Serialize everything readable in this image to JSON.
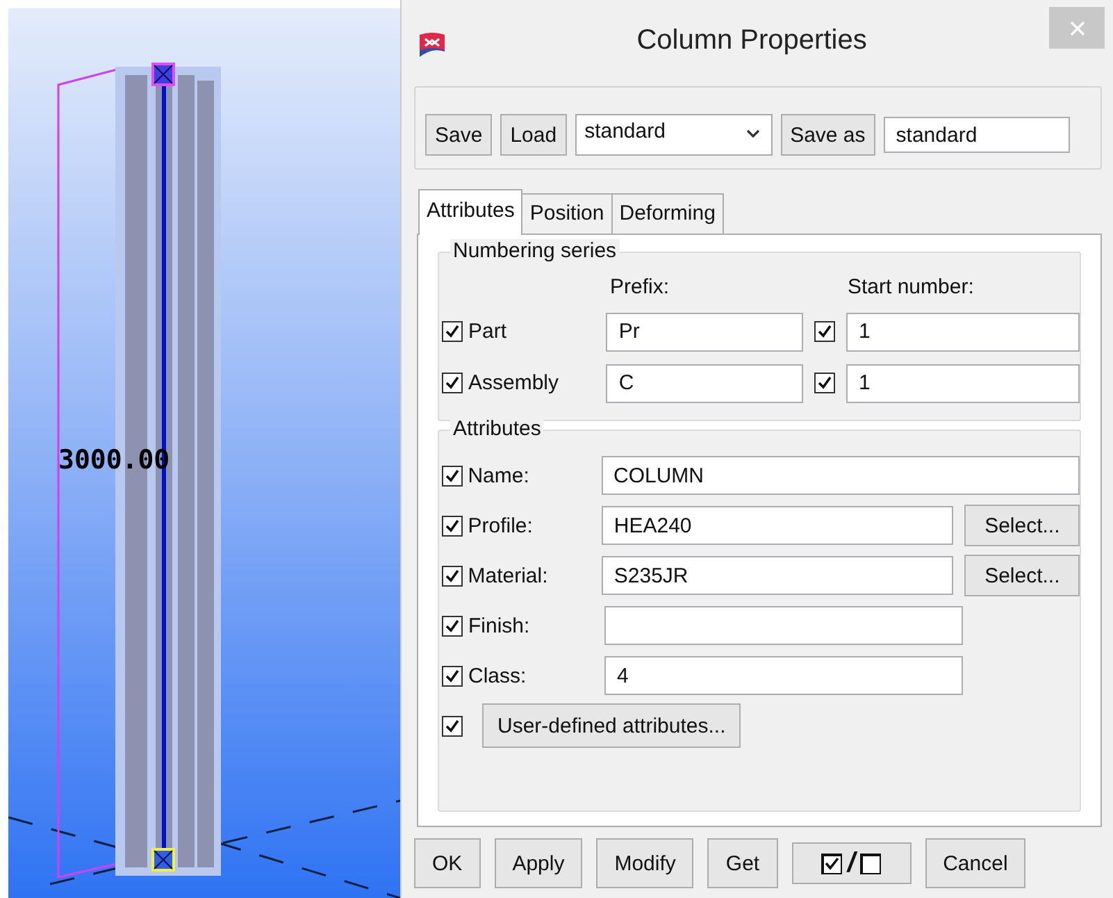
{
  "viewport": {
    "dimension_label": "3000.00"
  },
  "window": {
    "title": "Column Properties"
  },
  "toolbar": {
    "save": "Save",
    "load": "Load",
    "attribute_set": "standard",
    "save_as": "Save as",
    "save_as_name": "standard"
  },
  "tabs": [
    {
      "label": "Attributes",
      "selected": true
    },
    {
      "label": "Position",
      "selected": false
    },
    {
      "label": "Deforming",
      "selected": false
    }
  ],
  "numbering": {
    "title": "Numbering series",
    "prefix_header": "Prefix:",
    "start_header": "Start number:",
    "rows": [
      {
        "label": "Part",
        "checked": true,
        "prefix": "Pr",
        "start_checked": true,
        "start": "1"
      },
      {
        "label": "Assembly",
        "checked": true,
        "prefix": "C",
        "start_checked": true,
        "start": "1"
      }
    ]
  },
  "attributes": {
    "title": "Attributes",
    "rows": [
      {
        "kind": "text",
        "label": "Name:",
        "checked": true,
        "value": "COLUMN"
      },
      {
        "kind": "select",
        "label": "Profile:",
        "checked": true,
        "value": "HEA240",
        "button": "Select..."
      },
      {
        "kind": "select",
        "label": "Material:",
        "checked": true,
        "value": "S235JR",
        "button": "Select..."
      },
      {
        "kind": "short",
        "label": "Finish:",
        "checked": true,
        "value": ""
      },
      {
        "kind": "short",
        "label": "Class:",
        "checked": true,
        "value": "4"
      },
      {
        "kind": "button",
        "checked": true,
        "button": "User-defined attributes..."
      }
    ]
  },
  "buttons": [
    {
      "kind": "button",
      "label": "OK"
    },
    {
      "kind": "button",
      "label": "Apply"
    },
    {
      "kind": "button",
      "label": "Modify"
    },
    {
      "kind": "button",
      "label": "Get"
    },
    {
      "kind": "toggle",
      "separator": "/"
    },
    {
      "kind": "button",
      "label": "Cancel"
    }
  ]
}
